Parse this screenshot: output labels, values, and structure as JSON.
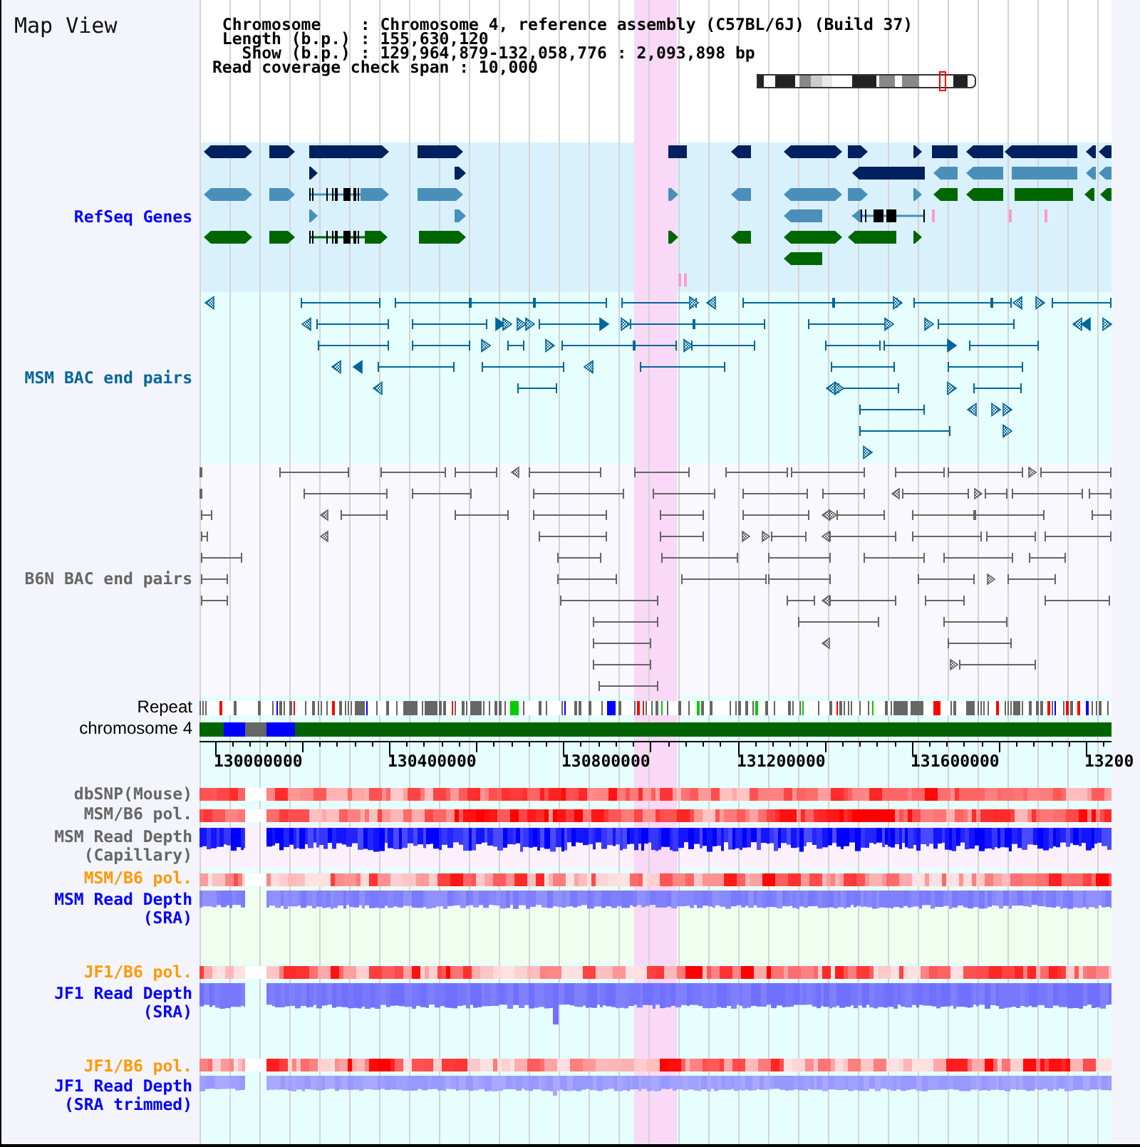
{
  "title": "Map View",
  "info": [
    "Chromosome    : Chromosome 4, reference assembly (C57BL/6J) (Build 37)",
    "Length (b.p.) : 155,630,120",
    "Show (b.p.) : 129,964,879-132,058,776 : 2,093,898 bp",
    "Read coverage check span : 10,000"
  ],
  "tracks": [
    {
      "label": "RefSeq Genes",
      "kind": "genes",
      "color": "#0000ff"
    },
    {
      "label": "MSM BAC end pairs",
      "kind": "bac_pairs",
      "color": "#006699"
    },
    {
      "label": "B6N BAC end pairs",
      "kind": "bac_pairs",
      "color": "#666666"
    },
    {
      "label": "Repeat",
      "kind": "repeat",
      "color": "#000000"
    },
    {
      "label": "chromosome 4",
      "kind": "chromosome",
      "color": "#000000"
    },
    {
      "kind": "axis",
      "tick_labels": [
        "130000000",
        "130400000",
        "130800000",
        "131200000",
        "131600000",
        "13200"
      ]
    },
    {
      "label": "dbSNP(Mouse)",
      "kind": "heatmap",
      "color": "#666666"
    },
    {
      "label": "MSM/B6 pol.",
      "kind": "heatmap",
      "color": "#666666"
    },
    {
      "label": "MSM Read Depth (Capillary)",
      "kind": "depth",
      "color": "#666666"
    },
    {
      "label": "MSM/B6 pol.",
      "kind": "heatmap",
      "color": "#ff9900"
    },
    {
      "label": "MSM Read Depth (SRA)",
      "kind": "depth",
      "color": "#0000ff"
    },
    {
      "label": "JF1/B6 pol.",
      "kind": "heatmap",
      "color": "#ff9900"
    },
    {
      "label": "JF1 Read Depth (SRA)",
      "kind": "depth",
      "color": "#0000ff"
    },
    {
      "label": "JF1/B6 pol.",
      "kind": "heatmap",
      "color": "#ff9900"
    },
    {
      "label": "JF1 Read Depth (SRA trimmed)",
      "kind": "depth",
      "color": "#0000ff"
    }
  ]
}
